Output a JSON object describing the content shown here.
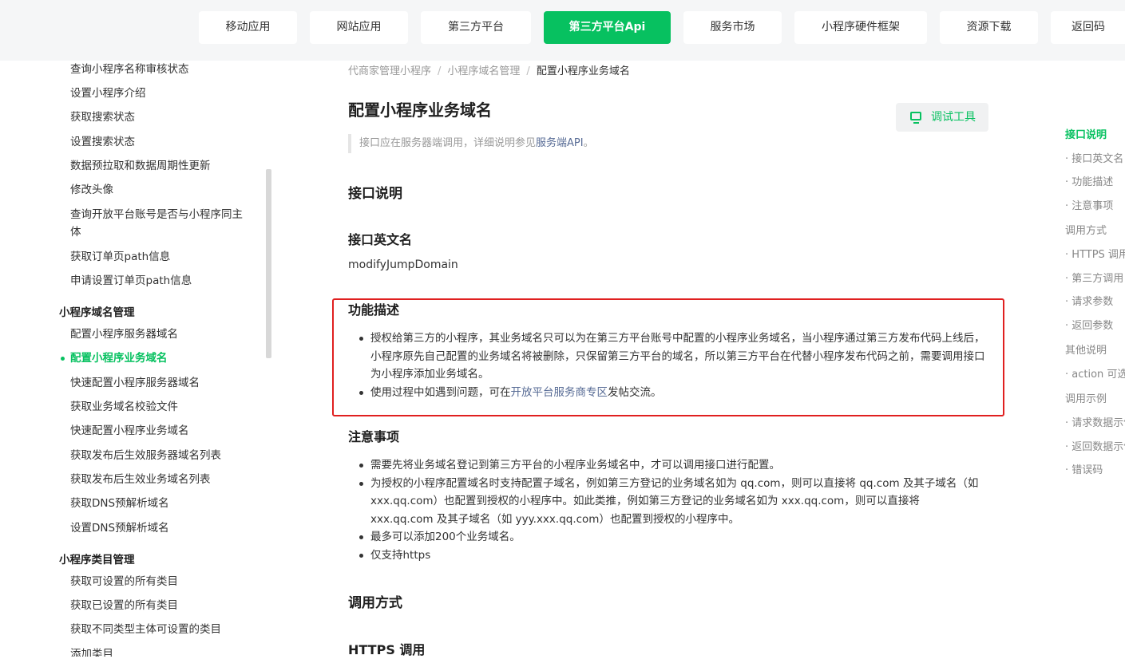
{
  "top_nav": [
    {
      "label": "移动应用"
    },
    {
      "label": "网站应用"
    },
    {
      "label": "第三方平台"
    },
    {
      "label": "第三方平台Api",
      "active": true
    },
    {
      "label": "服务市场"
    },
    {
      "label": "小程序硬件框架"
    },
    {
      "label": "资源下载"
    },
    {
      "label": "返回码"
    }
  ],
  "sidebar": {
    "items_top": [
      "查询小程序名称审核状态",
      "设置小程序介绍",
      "获取搜索状态",
      "设置搜索状态",
      "数据预拉取和数据周期性更新",
      "修改头像",
      "查询开放平台账号是否与小程序同主体",
      "获取订单页path信息",
      "申请设置订单页path信息"
    ],
    "group1": "小程序域名管理",
    "group1_items": [
      "配置小程序服务器域名",
      "配置小程序业务域名",
      "快速配置小程序服务器域名",
      "获取业务域名校验文件",
      "快速配置小程序业务域名",
      "获取发布后生效服务器域名列表",
      "获取发布后生效业务域名列表",
      "获取DNS预解析域名",
      "设置DNS预解析域名"
    ],
    "group2": "小程序类目管理",
    "group2_items": [
      "获取可设置的所有类目",
      "获取已设置的所有类目",
      "获取不同类型主体可设置的类目",
      "添加类目"
    ]
  },
  "breadcrumb": {
    "item1": "代商家管理小程序",
    "item2": "小程序域名管理",
    "current": "配置小程序业务域名",
    "sep": "/"
  },
  "page": {
    "title": "配置小程序业务域名",
    "debug_button": "调试工具",
    "note_prefix": "接口应在服务器端调用，详细说明参见",
    "note_link": "服务端API",
    "note_suffix": "。",
    "sec_interface": "接口说明",
    "sec_english_name": "接口英文名",
    "english_name": "modifyJumpDomain",
    "sec_function": "功能描述",
    "function_item1": "授权给第三方的小程序，其业务域名只可以为在第三方平台账号中配置的小程序业务域名，当小程序通过第三方发布代码上线后，小程序原先自己配置的业务域名将被删除，只保留第三方平台的域名，所以第三方平台在代替小程序发布代码之前，需要调用接口为小程序添加业务域名。",
    "function_item2_prefix": "使用过程中如遇到问题，可在",
    "function_item2_link": "开放平台服务商专区",
    "function_item2_suffix": "发帖交流。",
    "sec_notes": "注意事项",
    "notes": [
      "需要先将业务域名登记到第三方平台的小程序业务域名中，才可以调用接口进行配置。",
      "为授权的小程序配置域名时支持配置子域名，例如第三方登记的业务域名如为 qq.com，则可以直接将 qq.com 及其子域名（如 xxx.qq.com）也配置到授权的小程序中。如此类推，例如第三方登记的业务域名如为 xxx.qq.com，则可以直接将 xxx.qq.com 及其子域名（如 yyy.xxx.qq.com）也配置到授权的小程序中。",
      "最多可以添加200个业务域名。",
      "仅支持https"
    ],
    "sec_call": "调用方式",
    "sec_https": "HTTPS 调用"
  },
  "toc": [
    {
      "label": "接口说明",
      "active": true
    },
    {
      "label": "· 接口英文名"
    },
    {
      "label": "· 功能描述"
    },
    {
      "label": "· 注意事项"
    },
    {
      "label": "调用方式"
    },
    {
      "label": "· HTTPS 调用"
    },
    {
      "label": "· 第三方调用"
    },
    {
      "label": "· 请求参数"
    },
    {
      "label": "· 返回参数"
    },
    {
      "label": "其他说明"
    },
    {
      "label": "· action 可选值"
    },
    {
      "label": "调用示例"
    },
    {
      "label": "· 请求数据示例"
    },
    {
      "label": "· 返回数据示例"
    },
    {
      "label": "· 错误码"
    }
  ],
  "colors": {
    "accent": "#07c160",
    "link": "#576b95",
    "highlight_box": "#e02020"
  }
}
